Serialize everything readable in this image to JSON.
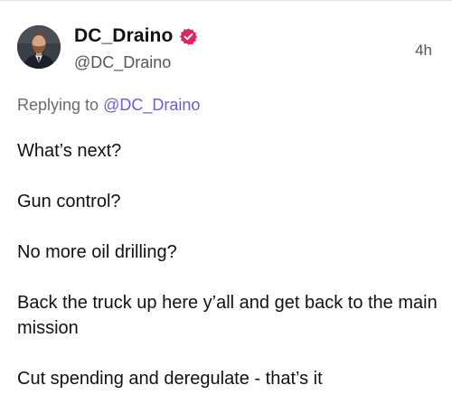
{
  "post": {
    "display_name": "DC_Draino",
    "verified_icon": "verified-badge-icon",
    "verified_color": "#e0245e",
    "handle": "@DC_Draino",
    "time": "4h",
    "reply_prefix": "Replying to",
    "reply_handle": "@DC_Draino",
    "accent_color": "#6f5bd6",
    "paragraphs": [
      "What’s next?",
      "Gun control?",
      "No more oil drilling?",
      "Back the truck up here y’all and get back to the main mission",
      "Cut spending and deregulate - that’s it"
    ]
  }
}
